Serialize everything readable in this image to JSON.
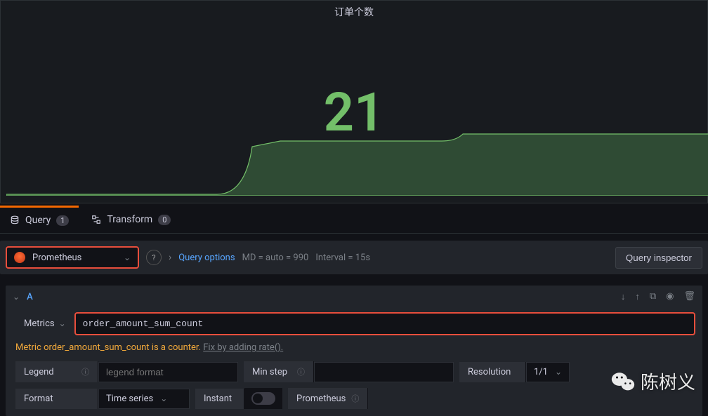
{
  "panel": {
    "title": "订单个数",
    "value": "21"
  },
  "chart_data": {
    "type": "area",
    "title": "订单个数",
    "xlabel": "",
    "ylabel": "",
    "x_unit": "relative position (0–1000)",
    "ylim": [
      0,
      30
    ],
    "series": [
      {
        "name": "order_amount_sum_count",
        "color": "#73bf69",
        "x": [
          0,
          300,
          350,
          390,
          620,
          650,
          1000
        ],
        "values": [
          0.5,
          0.5,
          17.5,
          19.5,
          19.5,
          22,
          22
        ]
      }
    ],
    "note": "x is normalized horizontal position; actual timestamps not visible in screenshot"
  },
  "tabs": {
    "query": {
      "label": "Query",
      "count": "1"
    },
    "transform": {
      "label": "Transform",
      "count": "0"
    }
  },
  "datasource": {
    "name": "Prometheus",
    "query_options_label": "Query options",
    "md_text": "MD = auto = 990",
    "interval_text": "Interval = 15s",
    "inspector_label": "Query inspector"
  },
  "query": {
    "letter": "A",
    "metrics_label": "Metrics",
    "metric_value": "order_amount_sum_count",
    "warning_prefix": "Metric order_amount_sum_count is a counter.",
    "warning_link": "Fix by adding rate().",
    "legend_label": "Legend",
    "legend_placeholder": "legend format",
    "minstep_label": "Min step",
    "resolution_label": "Resolution",
    "resolution_value": "1/1",
    "format_label": "Format",
    "format_value": "Time series",
    "instant_label": "Instant",
    "prometheus_label": "Prometheus"
  },
  "watermark": "陈树义"
}
